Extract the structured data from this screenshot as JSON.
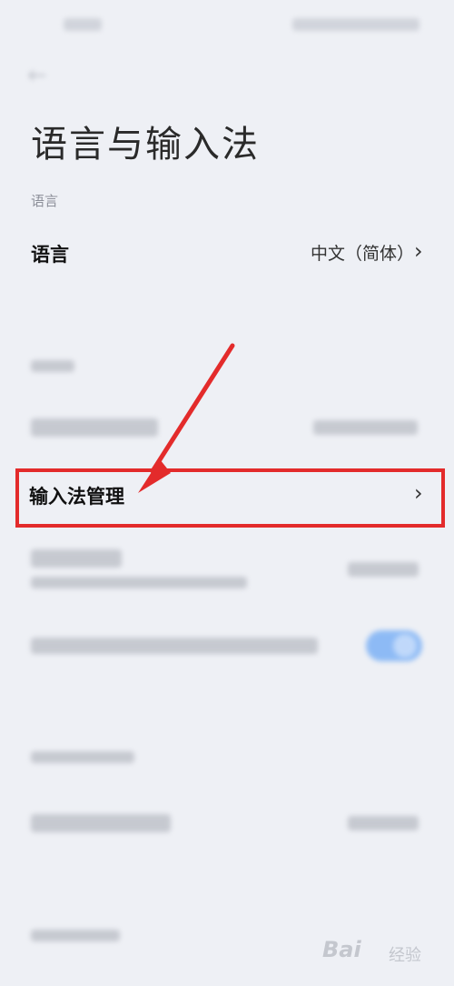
{
  "header": {
    "back_icon": "back-arrow-icon",
    "title": "语言与输入法"
  },
  "language_section": {
    "label": "语言",
    "row": {
      "label": "语言",
      "value": "中文（简体）",
      "chevron": "›"
    }
  },
  "ime_row": {
    "label": "输入法管理",
    "chevron": "›"
  },
  "toggle": {
    "state": "on",
    "color": "#3f8ff5"
  },
  "annotation": {
    "box_color": "#e32b2b",
    "arrow_color": "#e32b2b"
  },
  "watermark": {
    "text": "Bai",
    "sub": "经验"
  }
}
